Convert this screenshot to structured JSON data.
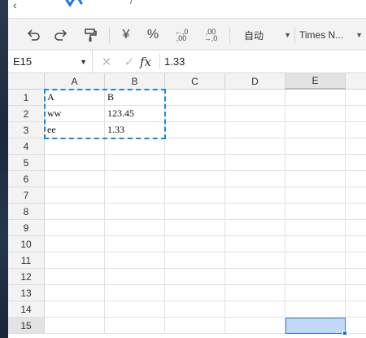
{
  "toolbar": {
    "currency_symbol": "¥",
    "percent_symbol": "%",
    "decimal_increase_top": "←,0",
    "decimal_increase_bottom": ",00",
    "decimal_decrease_top": ",00",
    "decimal_decrease_bottom": "→,0",
    "number_format_label": "自动",
    "font_name_label": "Times N..."
  },
  "formula_bar": {
    "name_box_value": "E15",
    "fx_label": "fx",
    "formula_value": "1.33"
  },
  "sheet": {
    "columns": [
      "A",
      "B",
      "C",
      "D",
      "E"
    ],
    "rows": [
      "1",
      "2",
      "3",
      "4",
      "5",
      "6",
      "7",
      "8",
      "9",
      "10",
      "11",
      "12",
      "13",
      "14",
      "15"
    ],
    "selected_column": "E",
    "selected_row": "15",
    "cells": {
      "A1": "A",
      "B1": "B",
      "A2": "ww",
      "B2": "123.45",
      "A3": "ee",
      "B3": "1.33"
    }
  },
  "colors": {
    "accent_blue": "#1a73e8",
    "marquee_blue": "#1a8ad4",
    "selection_fill": "#c2d9f7",
    "toolbar_bg": "#f3f3f3",
    "desktop_dark": "#1b2a3b"
  }
}
